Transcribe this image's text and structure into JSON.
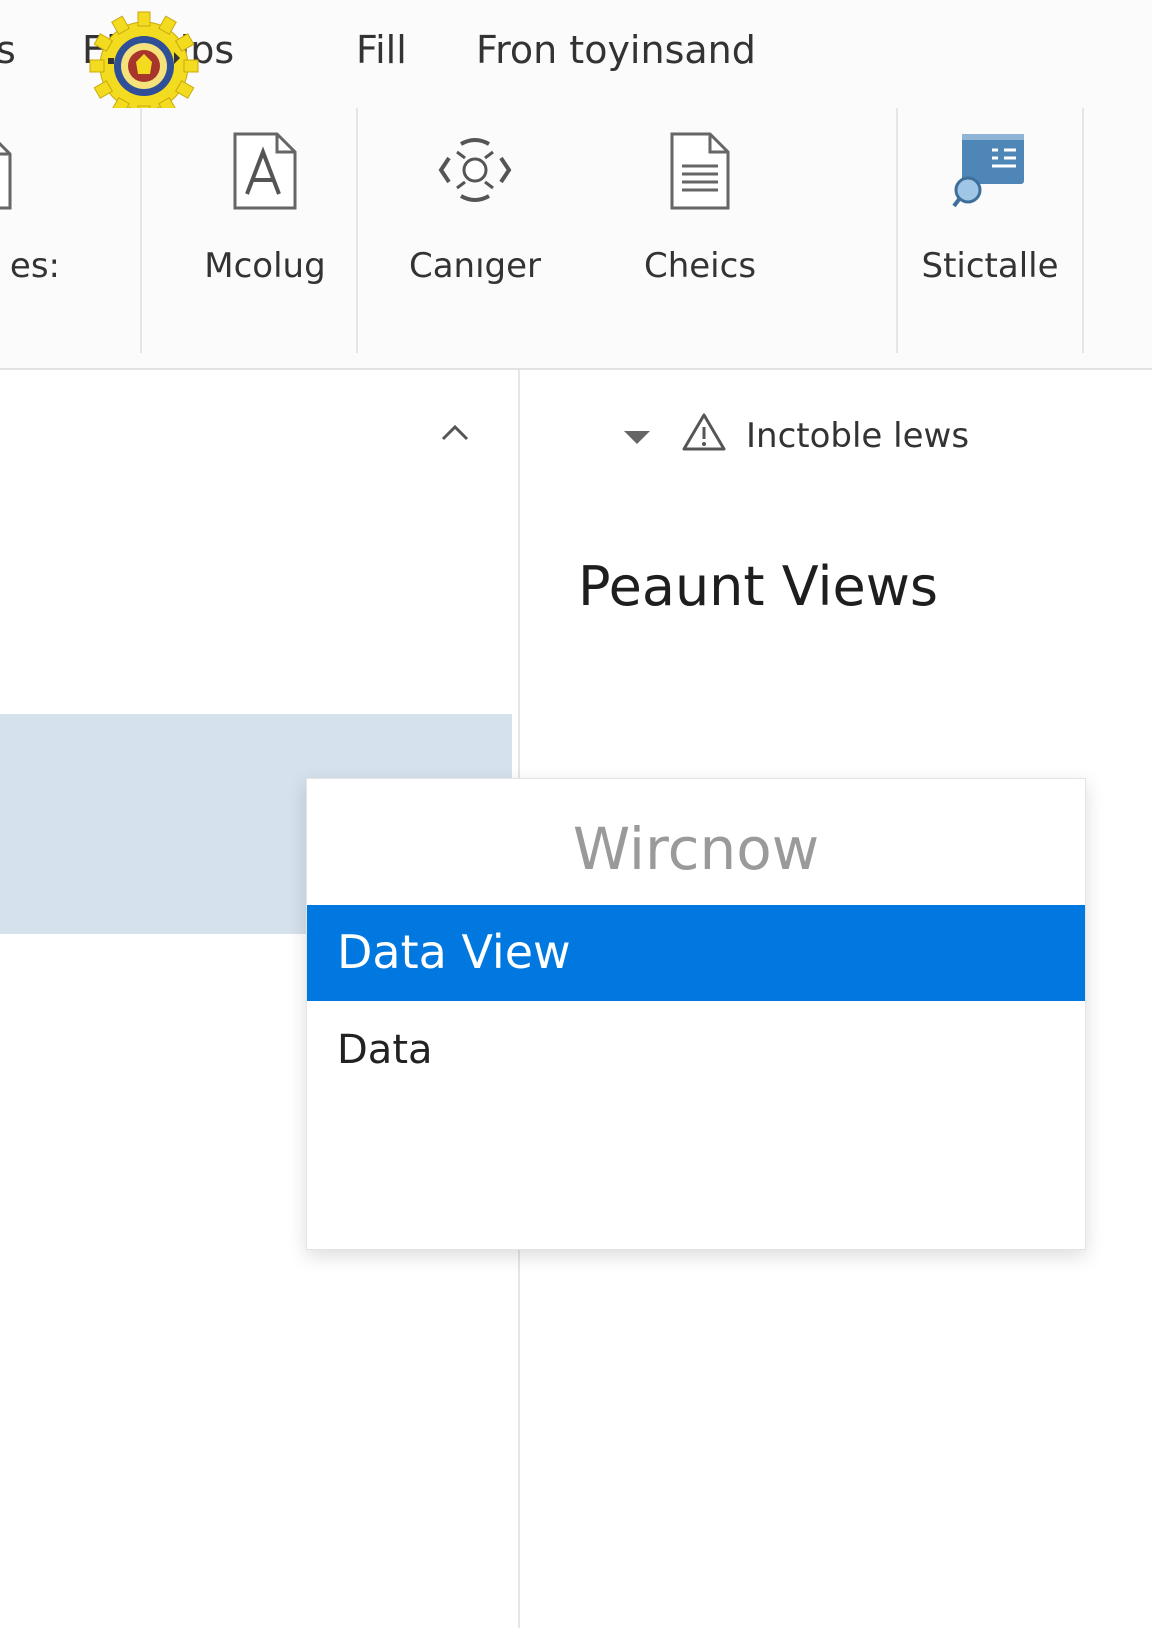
{
  "tabs": [
    {
      "label": "s"
    },
    {
      "label": "Eightlps"
    },
    {
      "label": "Fill"
    },
    {
      "label": "Fron toyinsand"
    }
  ],
  "logo": {
    "icon": "emblem-logo",
    "colors": {
      "gear": "#f3dc1f",
      "inner": "#a8352c",
      "ring": "#2f4f99"
    }
  },
  "ribbon": {
    "buttons": [
      {
        "label": "es:",
        "icon": "document-icon"
      },
      {
        "label": "Mcolug",
        "icon": "font-a-icon"
      },
      {
        "label": "Canıger",
        "icon": "transform-arrows-icon"
      },
      {
        "label": "Cheics",
        "icon": "text-document-icon"
      },
      {
        "label": "Stictalle",
        "icon": "presentation-chart-icon"
      }
    ]
  },
  "left_pane": {
    "collapse_icon": "chevron-up-icon",
    "selection_color": "#d6e1ee"
  },
  "right_pane": {
    "filter_caret_icon": "caret-down-icon",
    "warning_icon": "warning-triangle-icon",
    "warning_label": "Inctoble lews",
    "title": "Peaunt Views"
  },
  "popup": {
    "title": "Wircnow",
    "options": [
      {
        "label": "Data View",
        "selected": true
      },
      {
        "label": "Data",
        "selected": false
      }
    ],
    "accent": "#0078e0"
  }
}
